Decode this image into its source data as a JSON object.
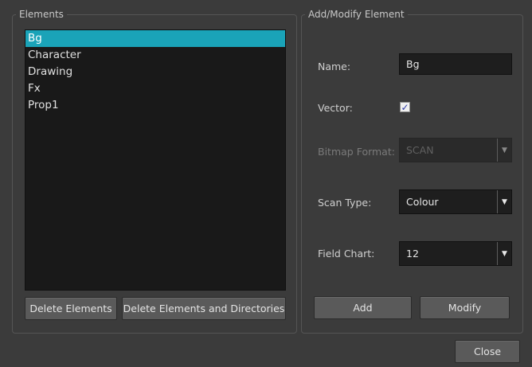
{
  "elements_group": {
    "title": "Elements",
    "items": [
      "Bg",
      "Character",
      "Drawing",
      "Fx",
      "Prop1"
    ],
    "selected_index": 0,
    "delete_elements_label": "Delete Elements",
    "delete_elements_dirs_label": "Delete Elements and Directories"
  },
  "modify_group": {
    "title": "Add/Modify Element",
    "name_label": "Name:",
    "name_value": "Bg",
    "vector_label": "Vector:",
    "vector_checked": true,
    "bitmap_format_label": "Bitmap Format:",
    "bitmap_format_value": "SCAN",
    "scan_type_label": "Scan Type:",
    "scan_type_value": "Colour",
    "field_chart_label": "Field Chart:",
    "field_chart_value": "12",
    "add_label": "Add",
    "modify_label": "Modify"
  },
  "dialog": {
    "close_label": "Close"
  },
  "colors": {
    "selection": "#1aa3b8",
    "background": "#3b3b3b"
  }
}
